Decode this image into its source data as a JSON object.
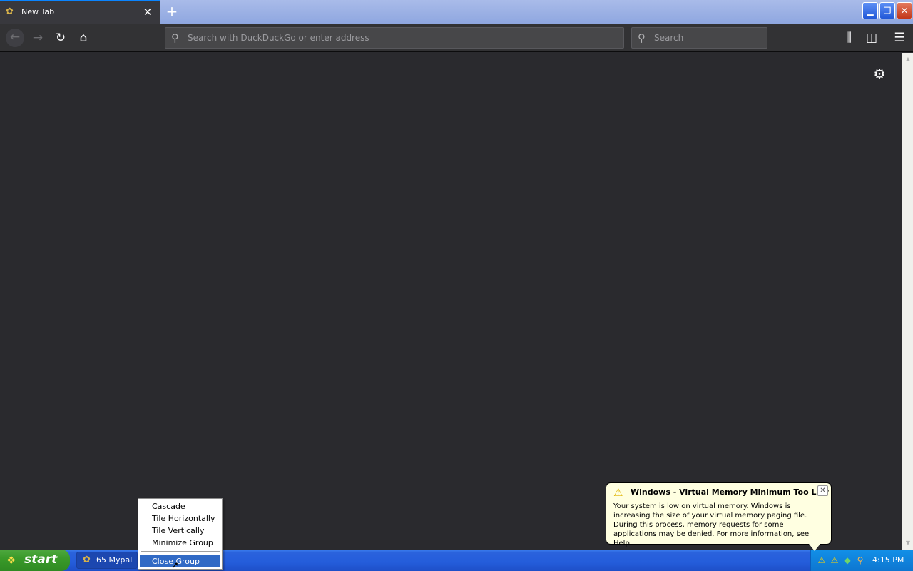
{
  "browser": {
    "tab": {
      "title": "New Tab",
      "favicon": "mypal-icon",
      "close": "✕"
    },
    "new_tab": "+",
    "window_buttons": {
      "minimize": "▁",
      "maximize": "❐",
      "close": "✕"
    }
  },
  "toolbar": {
    "back": "←",
    "forward": "→",
    "reload": "↻",
    "home": "⌂",
    "url": {
      "value": "",
      "placeholder": "Search with DuckDuckGo or enter address"
    },
    "search": {
      "value": "",
      "placeholder": "Search"
    },
    "library": "⫼",
    "sidebar": "◫",
    "menu": "☰"
  },
  "content": {
    "settings": "⚙"
  },
  "taskbar": {
    "start_label": "start",
    "task_button": {
      "label": "65 Mypal"
    },
    "clock": "4:15 PM"
  },
  "context_menu": {
    "items": [
      {
        "label": "Cascade"
      },
      {
        "label": "Tile Horizontally"
      },
      {
        "label": "Tile Vertically"
      },
      {
        "label": "Minimize Group"
      },
      {
        "label": "Close Group",
        "selected": true
      }
    ]
  },
  "balloon": {
    "title": "Windows - Virtual Memory Minimum Too Low",
    "body": "Your system is low on virtual memory. Windows is increasing the size of your virtual memory paging file. During this process, memory requests for some applications may be denied. For more information, see Help."
  },
  "colors": {
    "tab_accent": "#0a84ff",
    "menu_selected": "#316ac5",
    "balloon_bg": "#ffffe1",
    "start_green": "#3a9a2a"
  }
}
